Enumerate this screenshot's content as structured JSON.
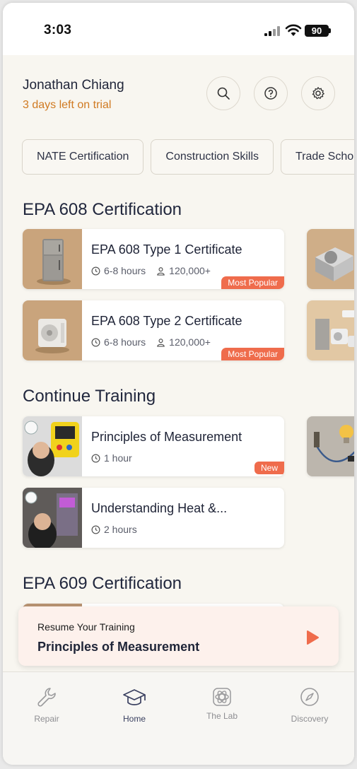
{
  "status_bar": {
    "time": "3:03",
    "battery": "90"
  },
  "header": {
    "user_name": "Jonathan Chiang",
    "trial_text": "3 days left on trial",
    "search_icon": "search-icon",
    "help_icon": "help-icon",
    "settings_icon": "gear-icon"
  },
  "chips": [
    "NATE Certification",
    "Construction Skills",
    "Trade Scho"
  ],
  "sections": {
    "epa608": "EPA 608 Certification",
    "continue": "Continue Training",
    "epa609": "EPA 609 Certification"
  },
  "epa608_cards": [
    {
      "title": "EPA 608 Type 1 Certificate",
      "duration": "6-8 hours",
      "learners": "120,000+",
      "badge": "Most Popular"
    },
    {
      "title": "EPA 608 Type 2 Certificate",
      "duration": "6-8 hours",
      "learners": "120,000+",
      "badge": "Most Popular"
    }
  ],
  "continue_cards": [
    {
      "title": "Principles of Measurement",
      "duration": "1 hour",
      "badge": "New"
    },
    {
      "title": "Understanding Heat &...",
      "duration": "2 hours"
    }
  ],
  "resume": {
    "label": "Resume Your Training",
    "title": "Principles of Measurement"
  },
  "tabs": [
    {
      "label": "Repair",
      "icon": "wrench-icon"
    },
    {
      "label": "Home",
      "icon": "graduation-cap-icon",
      "active": true
    },
    {
      "label": "The Lab",
      "icon": "atom-icon"
    },
    {
      "label": "Discovery",
      "icon": "compass-icon"
    }
  ],
  "colors": {
    "accent": "#ef6c4c",
    "trial": "#d07a22",
    "background": "#f8f6f0"
  }
}
